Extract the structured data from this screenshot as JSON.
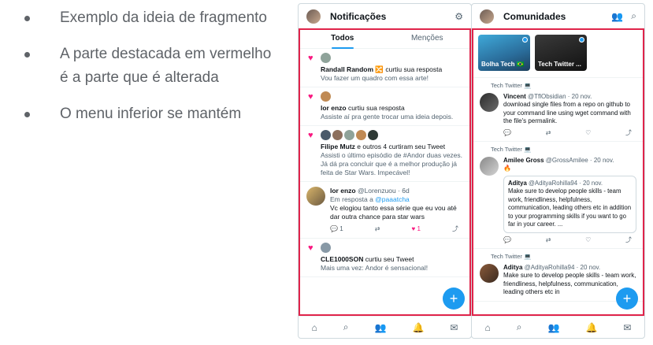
{
  "slide": {
    "bullets": [
      "Exemplo da ideia de fragmento",
      "A parte destacada em vermelho é a parte que é alterada",
      "O menu inferior se mantém"
    ]
  },
  "notifications": {
    "title": "Notificações",
    "tabs": [
      "Todos",
      "Menções"
    ],
    "items": [
      {
        "name": "Randall Random 🔀",
        "action": " curtiu sua resposta",
        "text": "Vou fazer um quadro com essa arte!"
      },
      {
        "name": "lor enzo",
        "action": " curtiu sua resposta",
        "text": "Assiste aí pra gente trocar uma ideia depois."
      },
      {
        "name": "Filipe Mutz",
        "action": " e outros 4 curtiram seu Tweet",
        "text": "Assisti o último episódio de #Andor duas vezes. Já dá pra concluir que é a melhor produção já feita de Star Wars. Impecável!"
      }
    ],
    "reply": {
      "name": "lor enzo",
      "handle": " @Lorenzuou · 6d",
      "reply_to_prefix": "Em resposta a ",
      "reply_to": "@paaatcha",
      "text": "Vc elogiou tanto essa série que eu vou até dar outra chance para star wars",
      "replies": "1",
      "likes": "1"
    },
    "last": {
      "name": "CLE1000SON",
      "action": " curtiu seu Tweet",
      "text": "Mais uma vez: Andor é sensacional!"
    }
  },
  "communities": {
    "title": "Comunidades",
    "cards": [
      "Bolha Tech 🇧🇷",
      "Tech Twitter ..."
    ],
    "posts": [
      {
        "context": "Tech Twitter 💻",
        "name": "Vincent",
        "handle": " @TflObsidian · 20 nov.",
        "text": "download single files from a repo on github to your command line using wget command with the file's permalink."
      },
      {
        "context": "Tech Twitter 💻",
        "name": "Amilee Gross",
        "handle": " @GrossAmilee · 20 nov.",
        "text": "🔥",
        "quote": {
          "name": "Aditya",
          "handle": " @AdityaRohilla94 · 20 nov.",
          "text": "Make sure to develop people skills - team work, friendliness, helpfulness, communication, leading others etc in addition to your programming skills if you want to go far in your career. ..."
        }
      },
      {
        "context": "Tech Twitter 💻",
        "name": "Aditya",
        "handle": " @AdityaRohilla94 · 20 nov.",
        "text": "Make sure to develop people skills - team work, friendliness, helpfulness, communication, leading others etc in"
      }
    ]
  },
  "icons": {
    "settings": "⚙",
    "add_person": "👥",
    "search": "🔍",
    "home": "🏠",
    "bell": "🔔",
    "mail": "✉"
  },
  "colors": {
    "accent": "#1d9bf0",
    "highlight": "#e0244a",
    "like": "#f91880"
  }
}
